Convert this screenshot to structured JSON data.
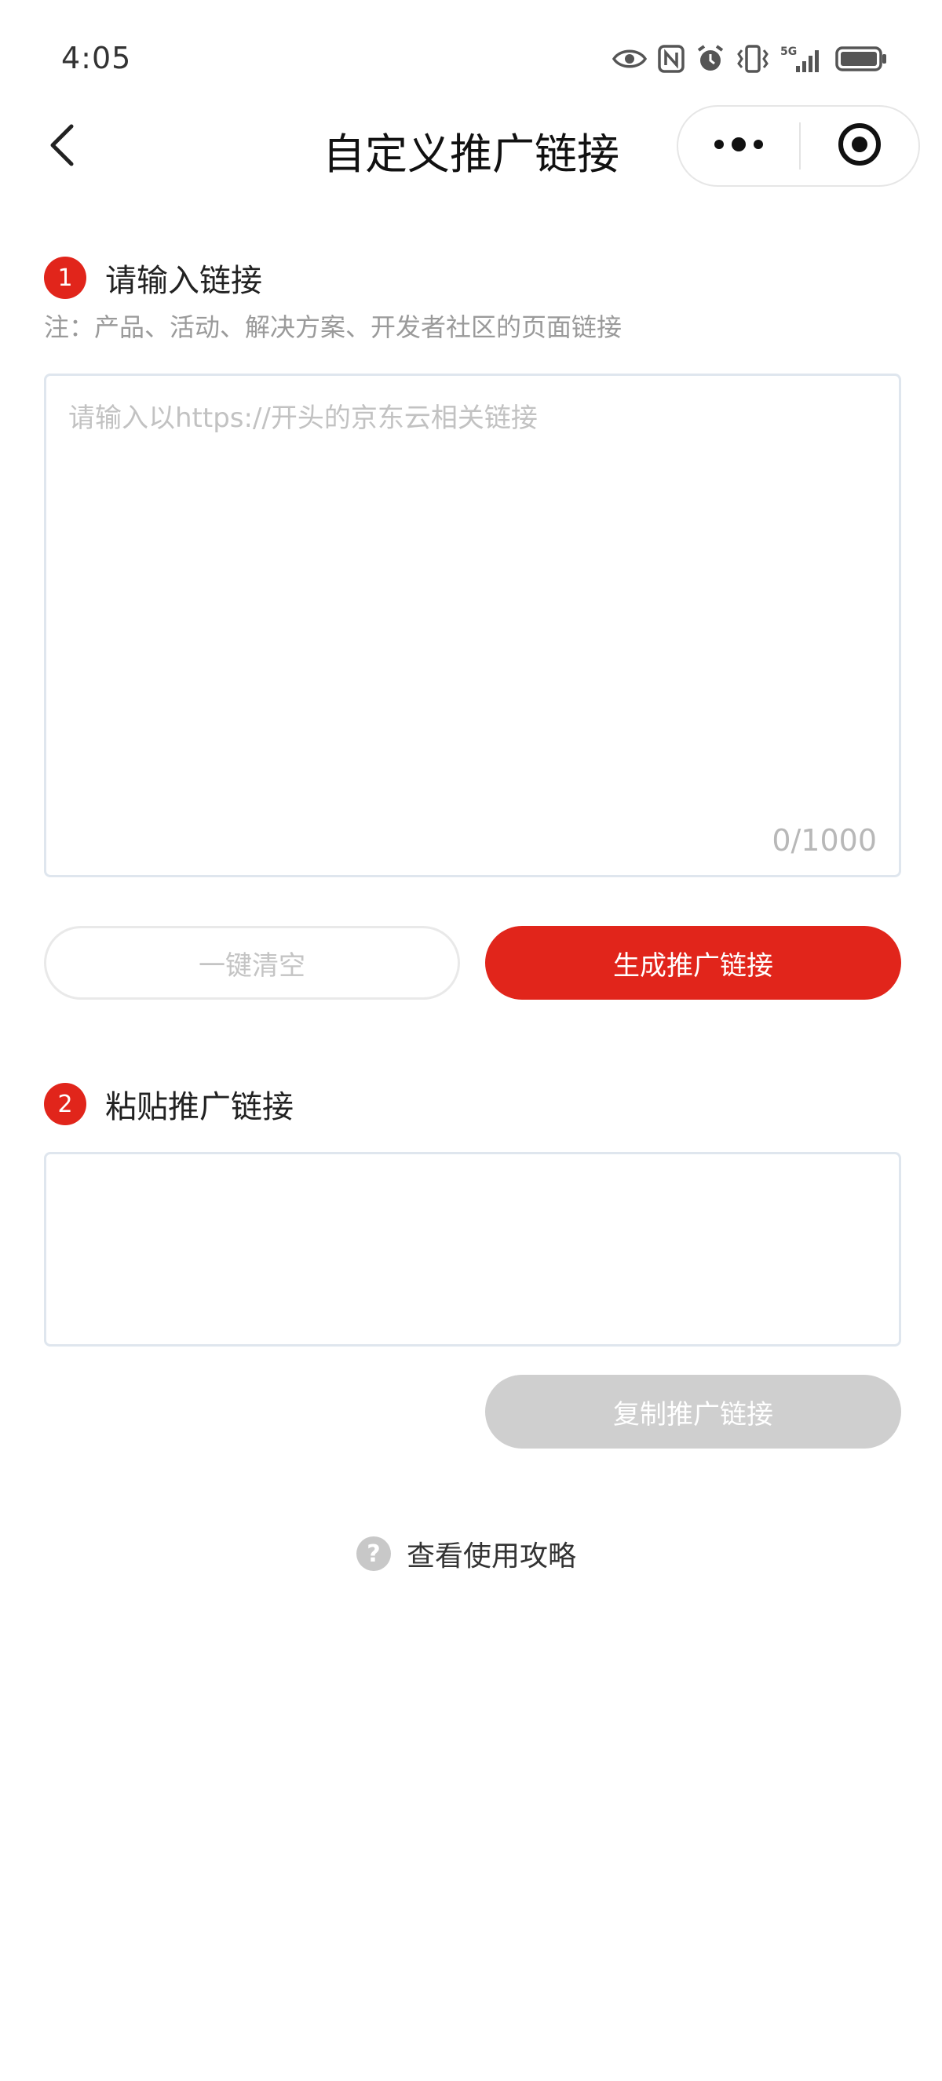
{
  "status_bar": {
    "time": "4:05",
    "icons": [
      "eye-icon",
      "nfc-icon",
      "alarm-icon",
      "vibrate-icon",
      "signal-5g-icon",
      "battery-icon"
    ],
    "network_label": "5G"
  },
  "nav": {
    "title": "自定义推广链接",
    "back_icon": "chevron-left-icon",
    "more_icon": "more-dots-icon",
    "close_icon": "target-close-icon"
  },
  "step1": {
    "number": "1",
    "title": "请输入链接",
    "note": "注：产品、活动、解决方案、开发者社区的页面链接",
    "input": {
      "placeholder": "请输入以https://开头的京东云相关链接",
      "value": "",
      "counter": "0/1000"
    },
    "clear_button": "一键清空",
    "generate_button": "生成推广链接"
  },
  "step2": {
    "number": "2",
    "title": "粘贴推广链接",
    "output_value": "",
    "copy_button": "复制推广链接"
  },
  "guide": {
    "icon": "question-icon",
    "label": "查看使用攻略"
  },
  "colors": {
    "accent": "#e1251b",
    "disabled": "#cfcfcf",
    "border": "#dfe6ee",
    "muted_text": "#9a9a9a"
  }
}
